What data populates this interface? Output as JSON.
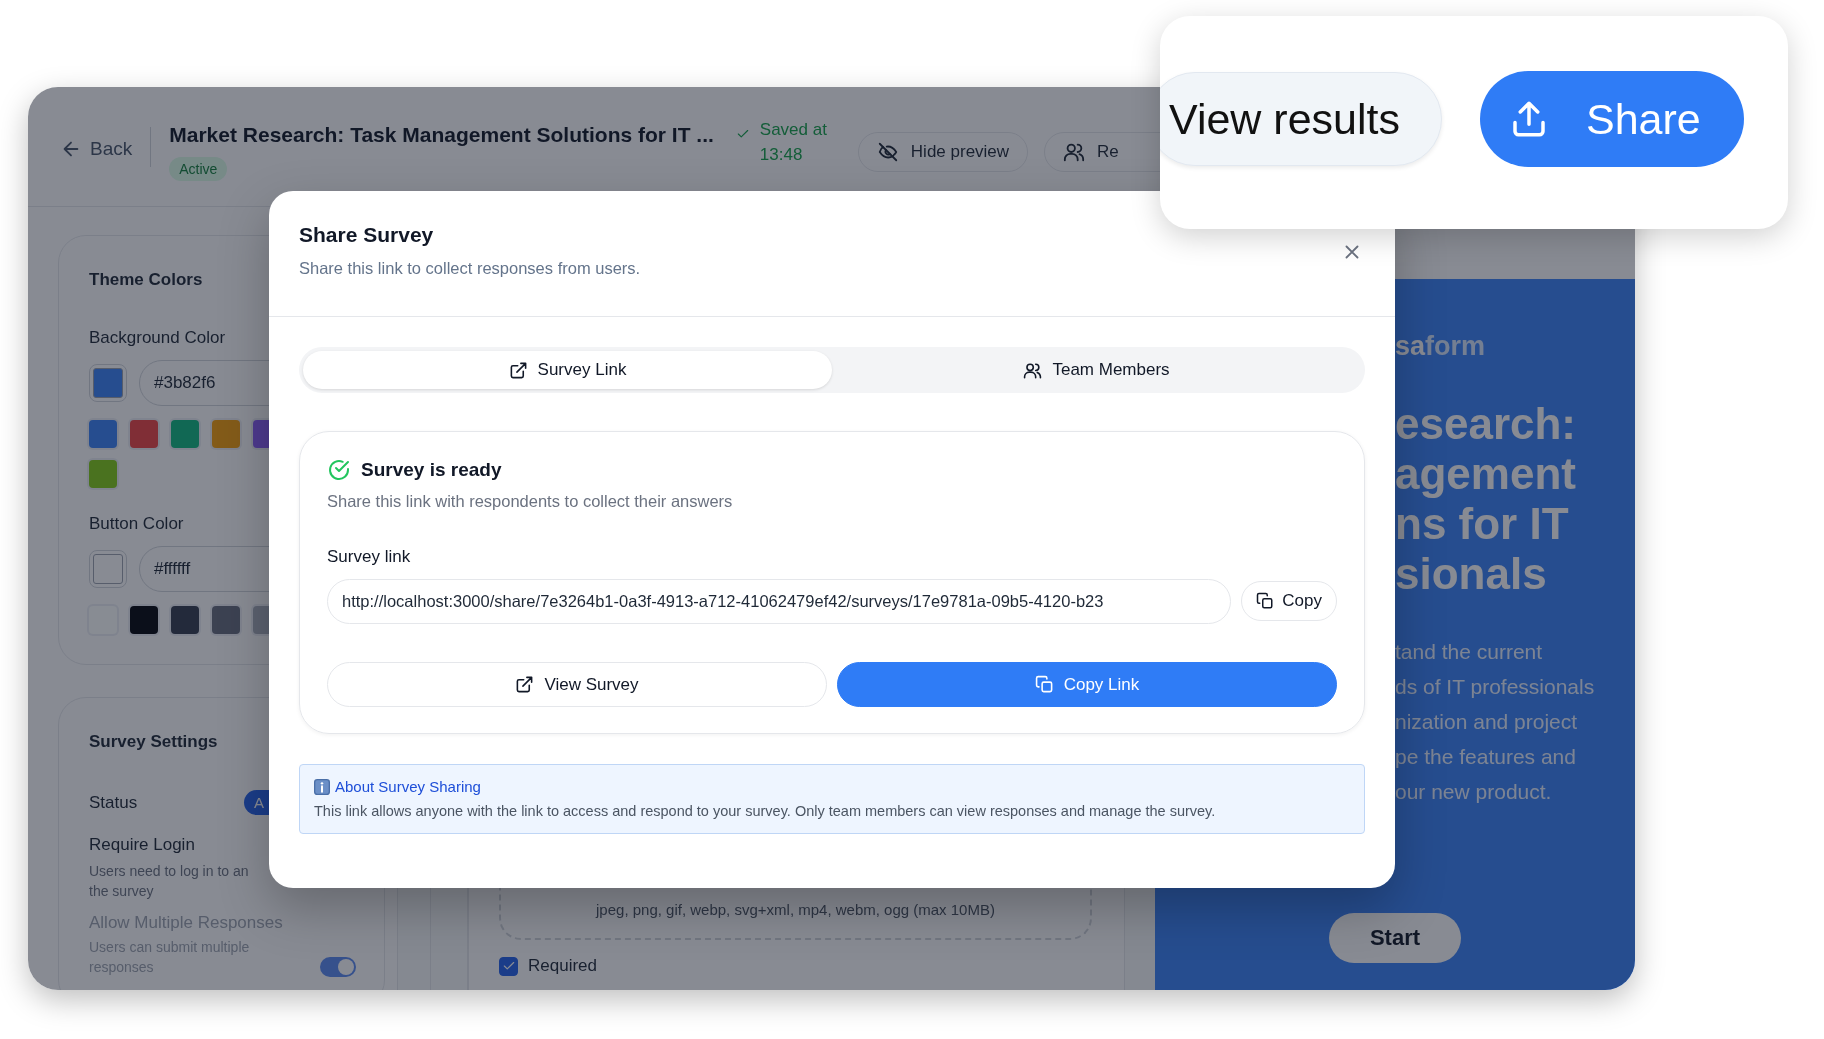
{
  "header": {
    "back": "Back",
    "title": "Market Research: Task Management Solutions for IT ...",
    "status": "Active",
    "saved": "Saved at 13:48",
    "buttons": [
      {
        "label": "Hide preview"
      },
      {
        "label": "Re"
      }
    ]
  },
  "sidebar": {
    "theme_colors": {
      "title": "Theme Colors",
      "background": {
        "label": "Background Color",
        "value": "#3b82f6",
        "presets": [
          {
            "color": "#264d8f"
          },
          {
            "color": "#802e36"
          },
          {
            "color": "#116854"
          },
          {
            "color": "#835b19"
          },
          {
            "color": "#4e3a8f"
          },
          {
            "color": "#4a721f"
          }
        ]
      },
      "button": {
        "label": "Button Color",
        "value": "#ffffff",
        "presets": [
          {
            "color": "#888c93"
          },
          {
            "color": "#0b0f1a"
          },
          {
            "color": "#232a3b"
          },
          {
            "color": "#3c4252"
          },
          {
            "color": "#5c6270"
          }
        ]
      }
    },
    "settings": {
      "title": "Survey Settings",
      "status": {
        "label": "Status",
        "badge": "A"
      },
      "require_login": {
        "label": "Require Login",
        "description_lines": [
          "Users need to log in to an",
          "the survey"
        ]
      },
      "multiple_responses": {
        "label": "Allow Multiple Responses",
        "description_lines": [
          "Users can submit multiple",
          "responses"
        ],
        "disabled": true,
        "on": true
      }
    }
  },
  "editor": {
    "upload_hint": "jpeg, png, gif, webp, svg+xml, mp4, webm, ogg (max 10MB)",
    "required": {
      "label": "Required",
      "checked": true
    }
  },
  "preview": {
    "brand_lead": "sa",
    "brand_rest": "form",
    "title_lines": [
      "esearch:",
      "agement",
      "ns for IT",
      "sionals"
    ],
    "description_lines": [
      "tand the current",
      "ds of IT professionals",
      "nization and project",
      "pe the features and",
      "our new product."
    ],
    "start": "Start"
  },
  "modal": {
    "title": "Share Survey",
    "subtitle": "Share this link to collect responses from users.",
    "tabs": [
      {
        "label": "Survey Link",
        "selected": true
      },
      {
        "label": "Team Members",
        "selected": false
      }
    ],
    "ready_title": "Survey is ready",
    "ready_description": "Share this link with respondents to collect their answers",
    "link_label": "Survey link",
    "link_value": "http://localhost:3000/share/7e3264b1-0a3f-4913-a712-41062479ef42/surveys/17e9781a-09b5-4120-b23",
    "copy": "Copy",
    "actions": [
      "View Survey",
      "Copy Link"
    ],
    "info_title": "About Survey Sharing",
    "info_body": "This link allows anyone with the link to access and respond to your survey. Only team members can view responses and manage the survey."
  },
  "callout": {
    "view_results": "View results",
    "share": "Share"
  }
}
